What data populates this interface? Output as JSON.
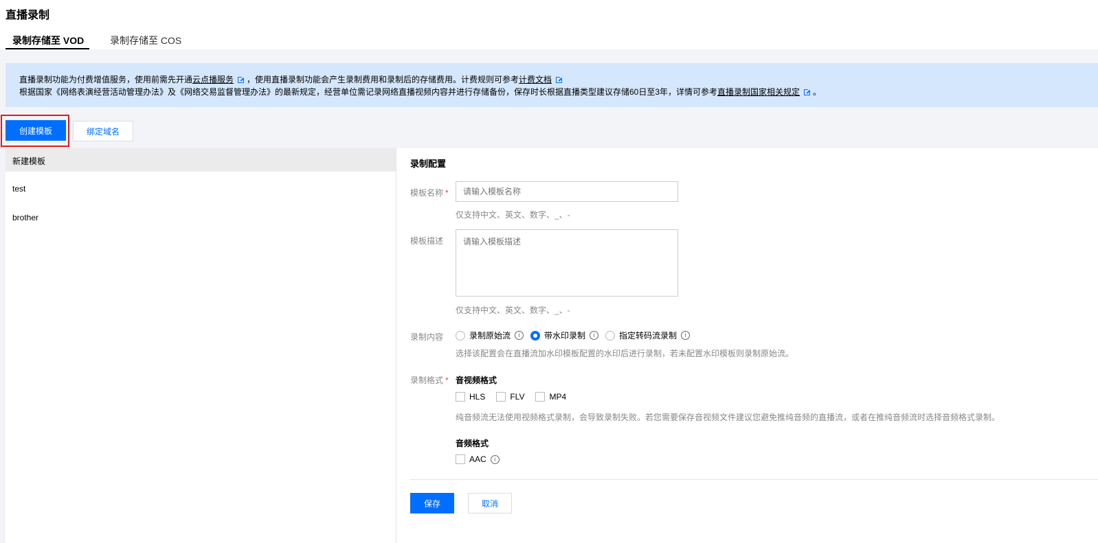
{
  "page": {
    "title": "直播录制"
  },
  "tabs": [
    {
      "label": "录制存储至 VOD",
      "active": true
    },
    {
      "label": "录制存储至 COS",
      "active": false
    }
  ],
  "notice": {
    "line1_prefix": "直播录制功能为付费增值服务，使用前需先开通",
    "line1_link1": "云点播服务",
    "line1_mid": "，使用直播录制功能会产生录制费用和录制后的存储费用。计费规则可参考",
    "line1_link2": "计费文档",
    "line2_prefix": "根据国家《网络表演经营活动管理办法》及《网络交易监督管理办法》的最新规定，经营单位需记录网络直播视频内容并进行存储备份，保存时长根据直播类型建议存储60日至3年，详情可参考",
    "line2_link": "直播录制国家相关规定",
    "line2_suffix": "。"
  },
  "toolbar": {
    "create_label": "创建模板",
    "bind_label": "绑定域名"
  },
  "templates": [
    {
      "label": "新建模板",
      "selected": true
    },
    {
      "label": "test",
      "selected": false
    },
    {
      "label": "brother",
      "selected": false
    }
  ],
  "form": {
    "section_title": "录制配置",
    "name_label": "模板名称",
    "name_placeholder": "请输入模板名称",
    "name_hint": "仅支持中文、英文、数字、_、-",
    "desc_label": "模板描述",
    "desc_placeholder": "请输入模板描述",
    "desc_hint": "仅支持中文、英文、数字、_、-",
    "content_label": "录制内容",
    "content_options": [
      {
        "label": "录制原始流",
        "checked": false
      },
      {
        "label": "带水印录制",
        "checked": true
      },
      {
        "label": "指定转码流录制",
        "checked": false
      }
    ],
    "content_hint": "选择该配置会在直播流加水印模板配置的水印后进行录制，若未配置水印模板则录制原始流。",
    "format_label": "录制格式",
    "av_format_title": "音视频格式",
    "av_formats": [
      "HLS",
      "FLV",
      "MP4"
    ],
    "av_hint": "纯音频流无法使用视频格式录制，会导致录制失败。若您需要保存音视频文件建议您避免推纯音频的直播流，或者在推纯音频流时选择音频格式录制。",
    "audio_format_title": "音频格式",
    "audio_formats": [
      "AAC"
    ],
    "save_label": "保存",
    "cancel_label": "取消"
  },
  "colors": {
    "primary": "#006eff",
    "notice_bg": "#d5e7fd",
    "highlight": "#e0191e",
    "required": "#e54545"
  }
}
